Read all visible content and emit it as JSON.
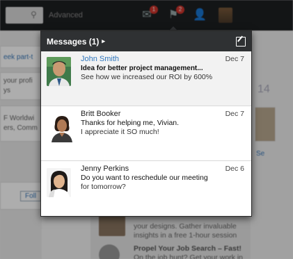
{
  "topbar": {
    "search_placeholder": "Advanced",
    "notification_badge": "1",
    "flag_badge": "2"
  },
  "background": {
    "left_link": "eek part-t",
    "left_lines": [
      "your profi",
      "ys",
      "F Worldwi",
      "ers, Comm"
    ],
    "follow_label": "Foll",
    "right_number": "14",
    "right_link": "Se",
    "bottom_line1": "your designs. Gather invaluable",
    "bottom_line2": "insights in a free 1-hour session",
    "bottom_title": "Propel Your Job Search – Fast!",
    "bottom_line3": "On the job hunt? Get your work in"
  },
  "messages_panel": {
    "title": "Messages (1)",
    "chevron_glyph": "▸",
    "messages": [
      {
        "sender": "John Smith",
        "date": "Dec 7",
        "subject": "Idea for better project management...",
        "snippet": "See how we increased our ROI by 600%",
        "unread": true
      },
      {
        "sender": "Britt Booker",
        "date": "Dec 7",
        "subject": "Thanks for helping me, Vivian.",
        "snippet": "I appreciate it SO much!",
        "unread": false
      },
      {
        "sender": "Jenny Perkins",
        "date": "Dec 6",
        "subject": "Do you want to reschedule our meeting",
        "snippet": "for tomorrow?",
        "unread": false
      }
    ]
  },
  "colors": {
    "header_bg": "#2f3133",
    "link_blue": "#2f77bd",
    "badge_red": "#d0342c"
  }
}
